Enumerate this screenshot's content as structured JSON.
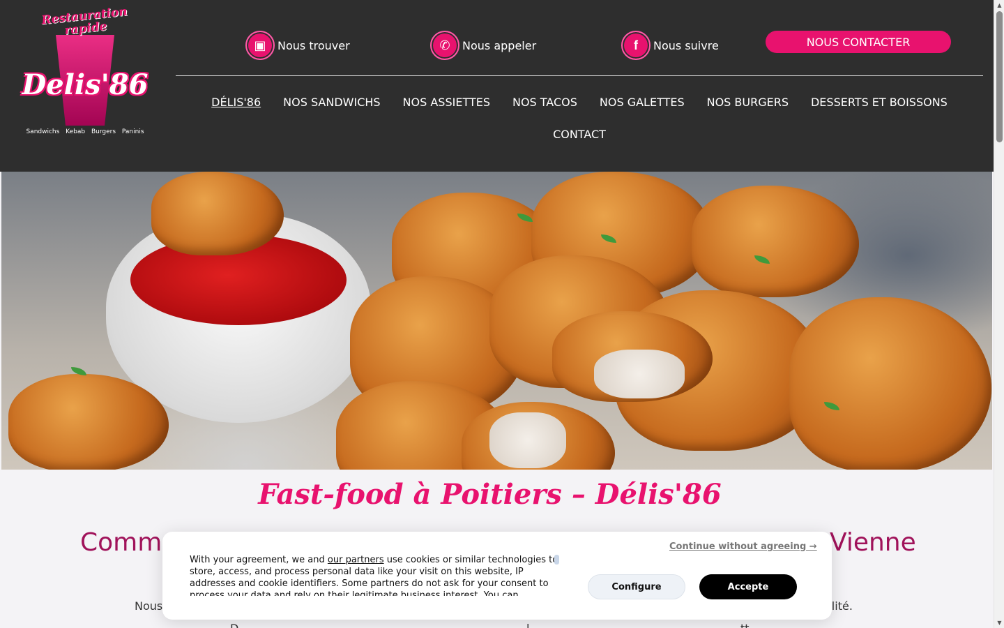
{
  "logo": {
    "tagline": "Restauration rapide",
    "name": "Delis'86",
    "subtitle": "Sandwichs Kebab Burgers Paninis"
  },
  "topbar": {
    "find": "Nous trouver",
    "call": "Nous appeler",
    "follow": "Nous suivre",
    "contact_button": "NOUS CONTACTER"
  },
  "nav": {
    "items": [
      "DÉLIS'86",
      "NOS SANDWICHS",
      "NOS ASSIETTES",
      "NOS TACOS",
      "NOS GALETTES",
      "NOS BURGERS",
      "DESSERTS ET BOISSONS",
      "CONTACT"
    ]
  },
  "content": {
    "title": "Fast-food à Poitiers – Délis'86",
    "subtitle_left": "Comm",
    "subtitle_right": "Vienne",
    "para_left": "Nous",
    "para_right": "alité.",
    "para2_left": "D",
    "para2_mid": "l",
    "para2_right": "tt"
  },
  "cookie": {
    "text_before": "With your agreement, we and ",
    "partners_link": "our partners",
    "text_after": " use cookies or similar technologies to store, access, and process personal data like your visit on this website, IP addresses and cookie identifiers. Some partners do not ask for your consent to process your data and rely on their legitimate business interest. You can",
    "continue": "Continue without agreeing →",
    "configure": "Configure",
    "accept": "Accepte"
  },
  "colors": {
    "brand_pink": "#e8126e",
    "header_bg": "#2e2e2e"
  },
  "icons": {
    "find": "store-icon",
    "call": "phone-icon",
    "follow": "facebook-icon"
  }
}
